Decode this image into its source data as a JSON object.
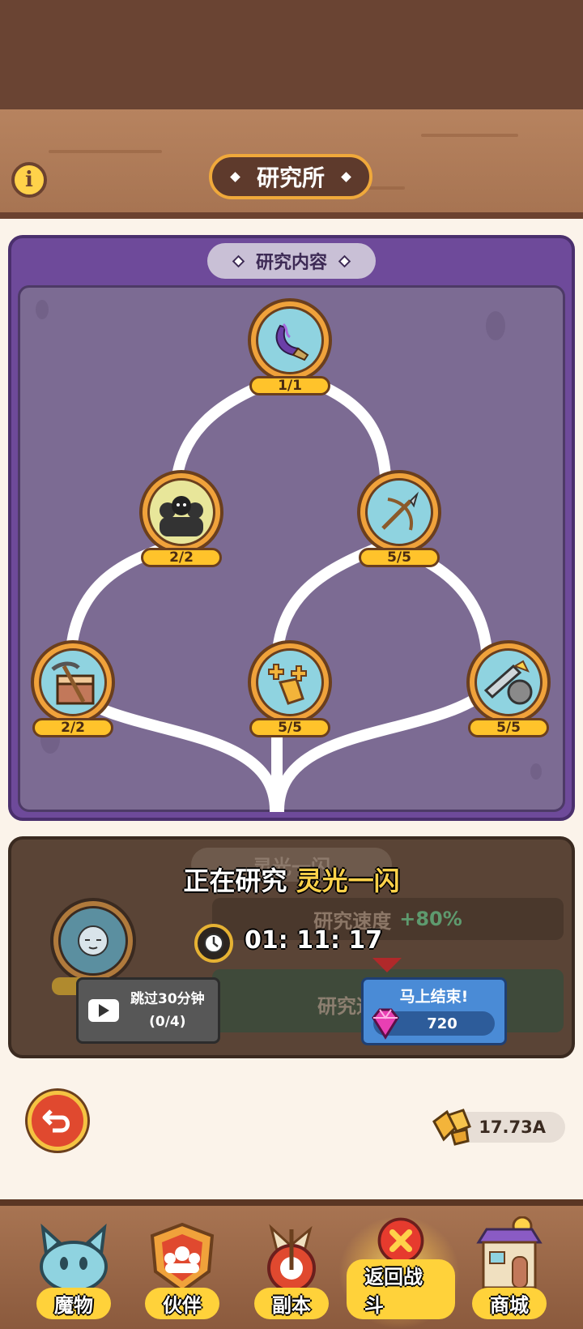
{
  "header": {
    "title": "研究所"
  },
  "research_panel": {
    "tag": "研究内容",
    "nodes": [
      {
        "id": "flash",
        "level": "1/1"
      },
      {
        "id": "crowd",
        "level": "2/2"
      },
      {
        "id": "spear",
        "level": "5/5"
      },
      {
        "id": "craft",
        "level": "2/2"
      },
      {
        "id": "gold",
        "level": "5/5"
      },
      {
        "id": "saw",
        "level": "5/5"
      }
    ]
  },
  "researching": {
    "ghost_tag": "灵光一闪",
    "prefix": "正在研究",
    "name": "灵光一闪",
    "speed_label": "研究速度",
    "speed_value": "+80%",
    "row2_label": "研究速",
    "timer": "01: 11: 17",
    "skip": {
      "line1": "跳过30分钟",
      "line2": "(0/4)"
    },
    "finish": {
      "label": "马上结束!",
      "cost": "720"
    }
  },
  "currency": {
    "gold": "17.73A"
  },
  "nav": [
    {
      "label": "魔物",
      "icon": "monster-icon"
    },
    {
      "label": "伙伴",
      "icon": "partner-icon"
    },
    {
      "label": "副本",
      "icon": "dungeon-icon"
    },
    {
      "label": "返回战斗",
      "icon": "close-battle-icon",
      "active": true
    },
    {
      "label": "商城",
      "icon": "shop-icon"
    }
  ],
  "colors": {
    "panel_purple": "#6e4a9a",
    "node_gold": "#f0a23b",
    "badge_yellow": "#ffc32b",
    "highlight": "#ffd24a",
    "finish_blue": "#4a8bd6"
  }
}
